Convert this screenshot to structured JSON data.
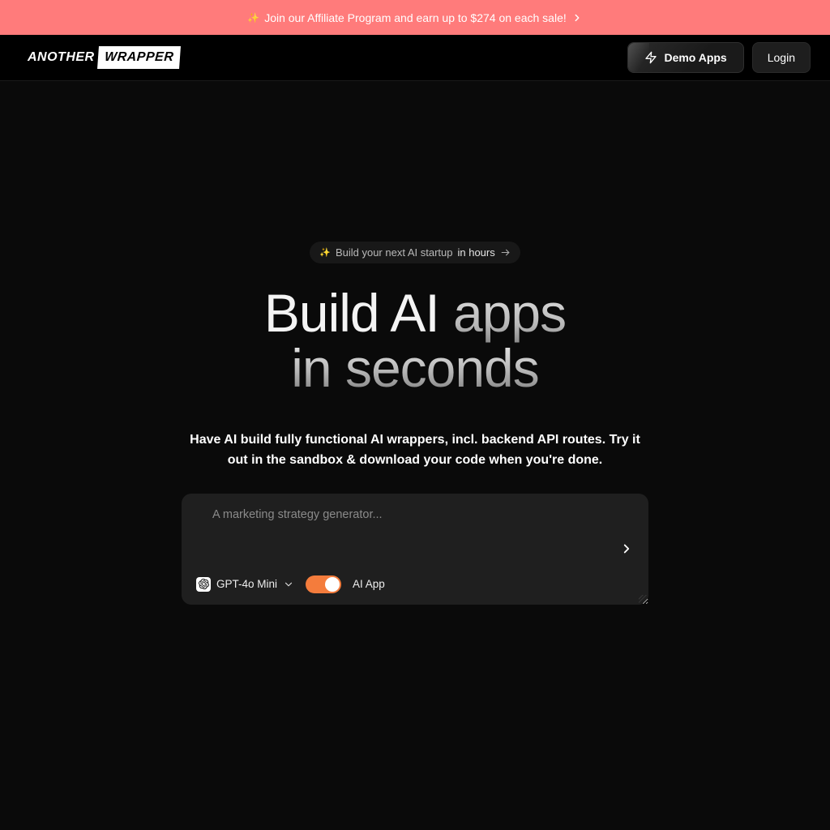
{
  "banner": {
    "text": "Join our Affiliate Program and earn up to $274 on each sale!"
  },
  "nav": {
    "logo_left": "ANOTHER",
    "logo_right": "WRAPPER",
    "demo_label": "Demo Apps",
    "login_label": "Login"
  },
  "hero": {
    "pill_pre": "Build your next AI startup ",
    "pill_bold": "in hours",
    "headline_l1_a": "Build AI ",
    "headline_l1_b": "apps",
    "headline_l2": "in seconds",
    "subhead": "Have AI build fully functional AI wrappers, incl. backend API routes. Try it out in the sandbox & download your code when you're done."
  },
  "prompt": {
    "placeholder": "A marketing strategy generator...",
    "model_label": "GPT-4o Mini",
    "toggle_label": "AI App"
  },
  "colors": {
    "banner_bg": "#ff7b7b",
    "toggle_on": "#f47c3c"
  }
}
